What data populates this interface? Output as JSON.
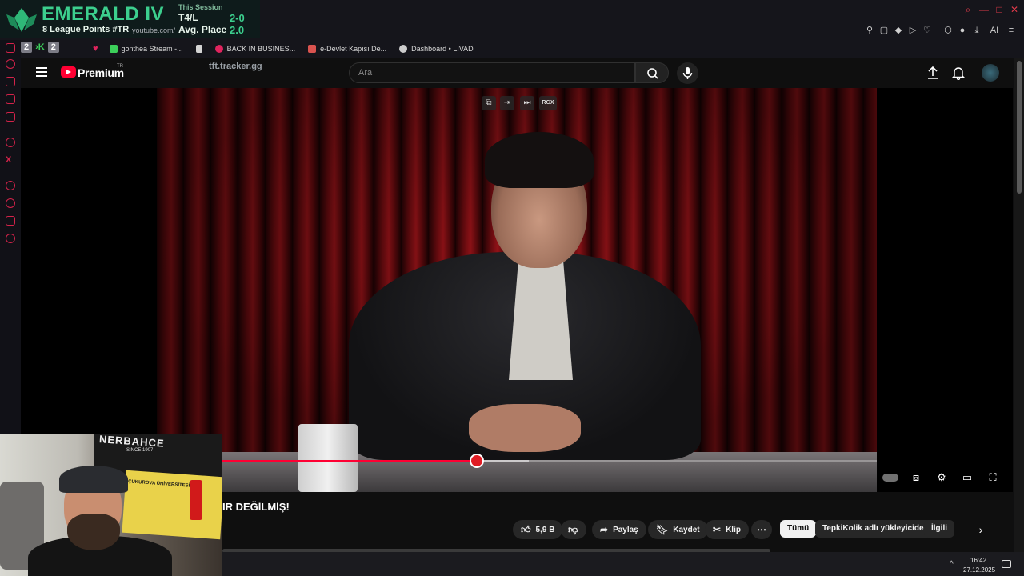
{
  "overlay": {
    "rank": "EMERALD IV",
    "league_points": "8 League Points #TR",
    "session_label": "This Session",
    "stat1_label": "T4/L",
    "stat1_value": "2-0",
    "stat2_label": "Avg. Place",
    "stat2_value": "2.0",
    "tracker": "tft.tracker.gg",
    "count_a": "2",
    "count_b": "2",
    "url_fragment": "youtube.com/"
  },
  "bookmarks": [
    {
      "label": "gonthea Stream -...",
      "icon_color": "#3ccf5a"
    },
    {
      "label": "BACK IN BUSINES...",
      "icon_color": "#e0245e"
    },
    {
      "label": "e-Devlet Kapısı De...",
      "icon_color": "#d9534f"
    },
    {
      "label": "Dashboard • LIVAD",
      "icon_color": "#cccccc"
    }
  ],
  "toolbar": {
    "ai_label": "AI"
  },
  "youtube": {
    "brand": "Premium",
    "country": "TR",
    "search_placeholder": "Ara",
    "accent": "#ff0033"
  },
  "player": {
    "progress": 0.39,
    "buffered": 0.47,
    "pip_labels": [
      "RGX"
    ]
  },
  "video": {
    "title": "IR DEĞİLMİŞ!",
    "like_count": "5,9 B",
    "share_label": "Paylaş",
    "save_label": "Kaydet",
    "clip_label": "Klip"
  },
  "chips": [
    "Tümü",
    "TepkiKolik adlı yükleyiciden",
    "İlgili"
  ],
  "taskbar": {
    "time": "16:42",
    "date": "27.12.2025"
  },
  "webcam": {
    "sign_text": "NERBAHCE",
    "sign_sub": "SINCE 1907",
    "banner_text": "ÇUKUROVA ÜNİVERSİTESİ"
  }
}
